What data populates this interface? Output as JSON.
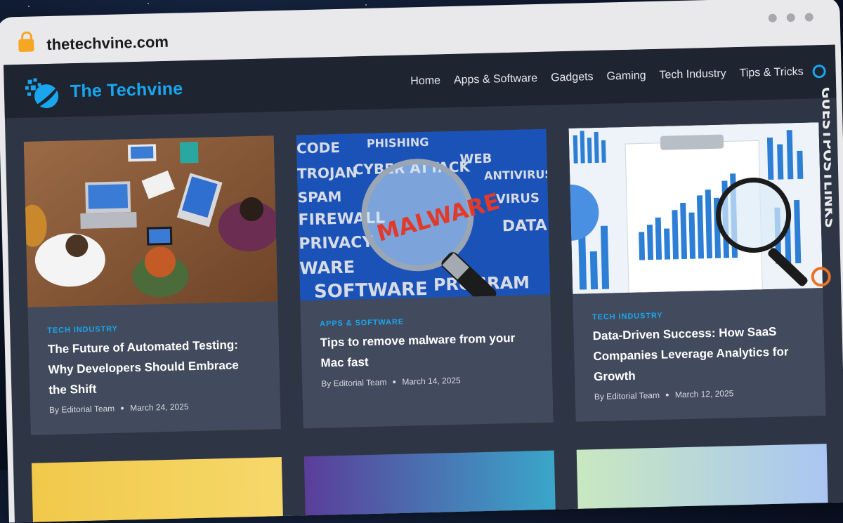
{
  "browser": {
    "url": "thetechvine.com"
  },
  "site": {
    "logo_text": "The Techvine",
    "nav": [
      "Home",
      "Apps & Software",
      "Gadgets",
      "Gaming",
      "Tech Industry",
      "Tips & Tricks"
    ]
  },
  "posts": [
    {
      "category": "TECH INDUSTRY",
      "title": "The Future of Automated Testing: Why Developers Should Embrace the Shift",
      "author": "By Editorial Team",
      "date": "March 24, 2025"
    },
    {
      "category": "APPS & SOFTWARE",
      "title": "Tips to remove malware from your Mac fast",
      "author": "By Editorial Team",
      "date": "March 14, 2025",
      "image_words": [
        "CODE",
        "PHISHING",
        "CYBER ATTACK",
        "TROJAN",
        "SPAM",
        "WEB",
        "ANTIVIRUS",
        "FIREWALL",
        "PRIVACY",
        "VIRUS",
        "MALWARE",
        "DATA",
        "WARE",
        "SOFTWARE",
        "PROGRAM"
      ]
    },
    {
      "category": "TECH INDUSTRY",
      "title": "Data-Driven Success: How SaaS Companies Leverage Analytics for Growth",
      "author": "By Editorial Team",
      "date": "March 12, 2025"
    }
  ],
  "watermark": "GUESTPOSTLINKS",
  "colors": {
    "accent": "#19a6ee",
    "header_bg": "#1e2430",
    "page_bg": "#2e3544",
    "card_bg": "#424b5d"
  }
}
